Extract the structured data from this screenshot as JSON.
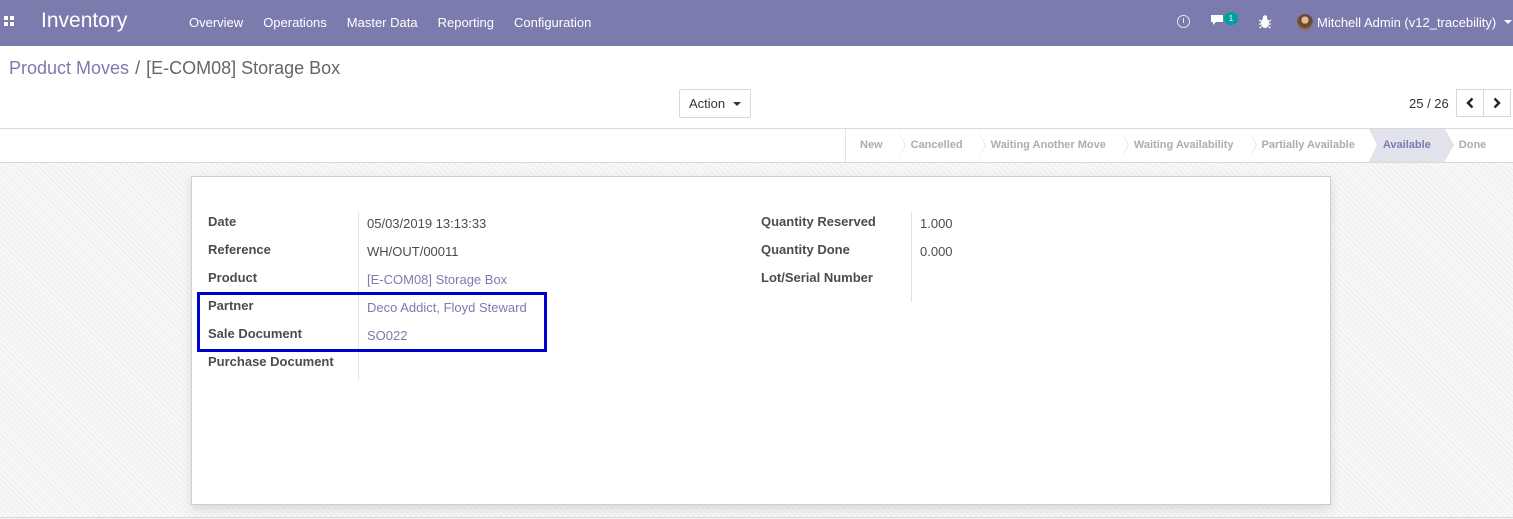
{
  "navbar": {
    "brand": "Inventory",
    "menu": [
      "Overview",
      "Operations",
      "Master Data",
      "Reporting",
      "Configuration"
    ],
    "chat_count": "1",
    "user": "Mitchell Admin (v12_tracebility)",
    "icons": [
      "apps-icon",
      "clock-icon",
      "chat-icon",
      "bug-icon"
    ]
  },
  "breadcrumb": {
    "parent": "Product Moves",
    "separator": "/",
    "current": "[E-COM08] Storage Box"
  },
  "action_label": "Action",
  "pager": {
    "value": "25 / 26"
  },
  "status_steps": [
    "New",
    "Cancelled",
    "Waiting Another Move",
    "Waiting Availability",
    "Partially Available",
    "Available",
    "Done"
  ],
  "status_active": "Available",
  "form": {
    "left": [
      {
        "label": "Date",
        "value": "05/03/2019 13:13:33",
        "link": false
      },
      {
        "label": "Reference",
        "value": "WH/OUT/00011",
        "link": false
      },
      {
        "label": "Product",
        "value": "[E-COM08] Storage Box",
        "link": true
      },
      {
        "label": "Partner",
        "value": "Deco Addict, Floyd Steward",
        "link": true
      },
      {
        "label": "Sale Document",
        "value": "SO022",
        "link": true
      },
      {
        "label": "Purchase Document",
        "value": "",
        "link": false
      }
    ],
    "right": [
      {
        "label": "Quantity Reserved",
        "value": "1.000"
      },
      {
        "label": "Quantity Done",
        "value": "0.000"
      },
      {
        "label": "Lot/Serial Number",
        "value": ""
      }
    ]
  },
  "colors": {
    "navbar": "#7c7bad",
    "link": "#7c7bad",
    "highlight": "#0000cc",
    "badge": "#00a09d"
  }
}
